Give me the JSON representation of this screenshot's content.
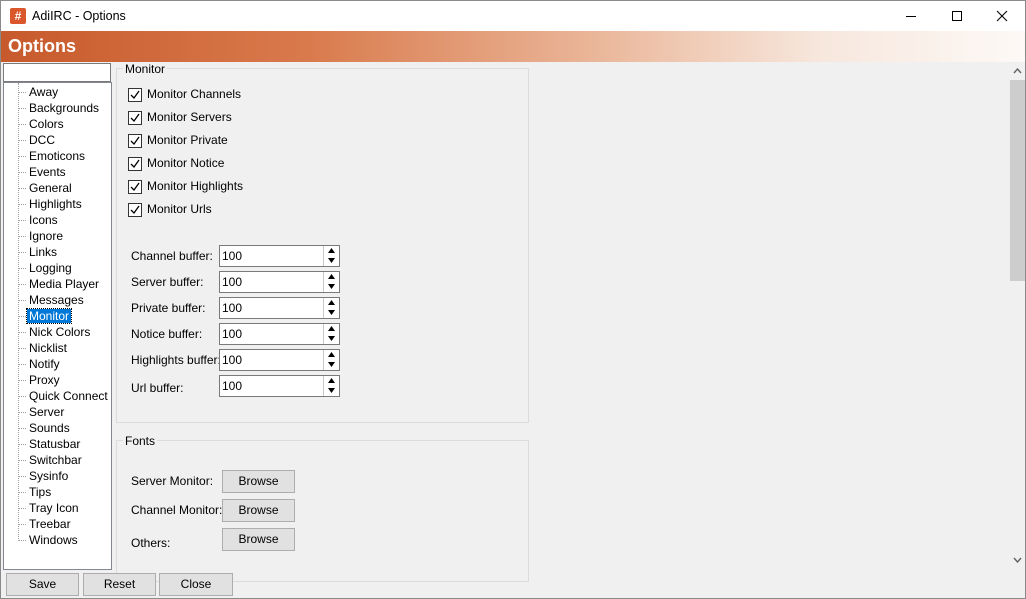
{
  "window": {
    "title": "AdiIRC - Options",
    "icon_glyph": "#",
    "icon_color": "#d9572b"
  },
  "header": {
    "title": "Options"
  },
  "search": {
    "value": ""
  },
  "tree": {
    "items": [
      "Away",
      "Backgrounds",
      "Colors",
      "DCC",
      "Emoticons",
      "Events",
      "General",
      "Highlights",
      "Icons",
      "Ignore",
      "Links",
      "Logging",
      "Media Player",
      "Messages",
      "Monitor",
      "Nick Colors",
      "Nicklist",
      "Notify",
      "Proxy",
      "Quick Connect",
      "Server",
      "Sounds",
      "Statusbar",
      "Switchbar",
      "Sysinfo",
      "Tips",
      "Tray Icon",
      "Treebar",
      "Windows"
    ],
    "selected": "Monitor"
  },
  "monitor": {
    "label": "Monitor",
    "checkboxes": [
      {
        "label": "Monitor Channels",
        "checked": true
      },
      {
        "label": "Monitor Servers",
        "checked": true
      },
      {
        "label": "Monitor Private",
        "checked": true
      },
      {
        "label": "Monitor Notice",
        "checked": true
      },
      {
        "label": "Monitor Highlights",
        "checked": true
      },
      {
        "label": "Monitor Urls",
        "checked": true
      }
    ],
    "buffers": [
      {
        "label": "Channel buffer:",
        "value": "100"
      },
      {
        "label": "Server buffer:",
        "value": "100"
      },
      {
        "label": "Private buffer:",
        "value": "100"
      },
      {
        "label": "Notice buffer:",
        "value": "100"
      },
      {
        "label": "Highlights buffer:",
        "value": "100"
      },
      {
        "label": "Url buffer:",
        "value": "100"
      }
    ]
  },
  "fonts": {
    "label": "Fonts",
    "rows": [
      {
        "label": "Server Monitor:",
        "button": "Browse"
      },
      {
        "label": "Channel Monitor:",
        "button": "Browse"
      },
      {
        "label": "Others:",
        "button": "Browse"
      }
    ]
  },
  "footer": {
    "save": "Save",
    "reset": "Reset",
    "close": "Close"
  }
}
